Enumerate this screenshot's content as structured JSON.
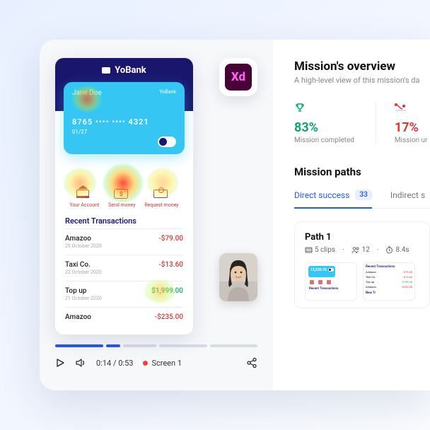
{
  "player": {
    "phone": {
      "app_name": "YoBank",
      "card": {
        "name": "Jane Doe",
        "bank": "YoBank",
        "number": "8765 •••• •••• 4321",
        "expiry": "01/27"
      },
      "actions": {
        "account": "Your Account",
        "send": "Send money",
        "request": "Request money"
      },
      "tx_title": "Recent Transactions",
      "transactions": [
        {
          "merchant": "Amazoo",
          "date": "29 October 2020",
          "amount": "-$79.00",
          "sign": "neg"
        },
        {
          "merchant": "Taxi Co.",
          "date": "22 October 2020",
          "amount": "-$13.60",
          "sign": "neg"
        },
        {
          "merchant": "Top up",
          "date": "21 October 2020",
          "amount": "$1,999.00",
          "sign": "pos"
        },
        {
          "merchant": "Amazoo",
          "date": "",
          "amount": "-$235.00",
          "sign": "neg"
        }
      ]
    },
    "xd_label": "Xd",
    "time_current": "0:14",
    "time_total": "0:53",
    "screen_label": "Screen 1"
  },
  "overview": {
    "title": "Mission's overview",
    "subtitle": "A high-level view of this mission's da",
    "stats": {
      "completed_pct": "83%",
      "completed_label": "Mission completed",
      "incomplete_pct": "17%",
      "incomplete_label": "Mission ur"
    },
    "paths_title": "Mission paths",
    "tabs": {
      "direct": "Direct success",
      "direct_count": "33",
      "indirect": "Indirect s"
    },
    "path1": {
      "title": "Path 1",
      "clips": "5 clips",
      "people": "12",
      "time": "8.4s",
      "thumb_amount": "12,530.70",
      "thumb_section": "Recent Transactions"
    }
  },
  "thumb2": {
    "hdr": "Recent Transactions",
    "rows": [
      {
        "m": "Amazoo",
        "a": "-$79.00",
        "s": "n"
      },
      {
        "m": "Taxi Co.",
        "a": "-$13.60",
        "s": "n"
      },
      {
        "m": "Top up",
        "a": "$199.00",
        "s": "p"
      },
      {
        "m": "Amazoo",
        "a": "-$235.00",
        "s": "n"
      }
    ],
    "newt": "New Tr"
  }
}
